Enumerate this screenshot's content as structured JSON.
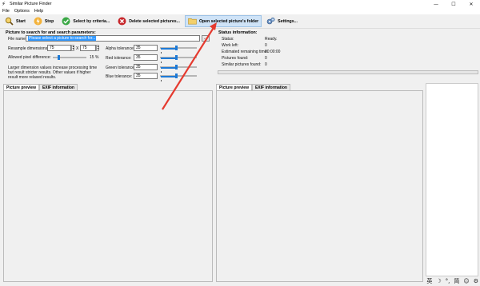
{
  "window": {
    "title": "Similar Picture Finder",
    "controls": {
      "minimize": "—",
      "maximize": "☐",
      "close": "✕"
    }
  },
  "menu": {
    "items": [
      "File",
      "Options",
      "Help"
    ]
  },
  "toolbar": {
    "start": "Start",
    "stop": "Stop",
    "select_by_criteria": "Select by criteria...",
    "delete_selected": "Delete selected pictures...",
    "open_folder": "Open selected picture's folder",
    "settings": "Settings..."
  },
  "search": {
    "group_title": "Picture to search for and search parameters:",
    "file_name_label": "File name:",
    "file_name_value": "Please select a picture to search for...",
    "browse_label": "...",
    "resample_label": "Resample dimensions:",
    "resample_w": "75",
    "resample_x": "X",
    "resample_h": "75",
    "allowed_diff_label": "Allowed pixel difference:",
    "allowed_diff_value": "15 %",
    "allowed_diff_level": 0.15,
    "hint": "Larger dimension values increase processing time but result stricter results. Other values if higher result more relaxed results.",
    "alpha_label": "Alpha tolerance:",
    "alpha_value": "35",
    "red_label": "Red tolerance:",
    "red_value": "35",
    "green_label": "Green tolerance:",
    "green_value": "35",
    "blue_label": "Blue tolerance:",
    "blue_value": "35"
  },
  "left_tabs": {
    "preview": "Picture preview",
    "exif": "EXIF information"
  },
  "status": {
    "group_title": "Status information:",
    "status_label": "Status:",
    "status_value": "Ready.",
    "work_left_label": "Work left:",
    "work_left_value": "0",
    "remaining_label": "Estimated remaining time:",
    "remaining_value": "00:00:00",
    "pictures_found_label": "Pictures found:",
    "pictures_found_value": "0",
    "similar_found_label": "Similar pictures found:",
    "similar_found_value": "0"
  },
  "right_tabs": {
    "preview": "Picture preview",
    "exif": "EXIF information"
  },
  "tray": {
    "ime": "英",
    "moon": "☽",
    "dot": "°,",
    "simplified": "简",
    "smile": "☺",
    "gear": "⚙"
  },
  "colors": {
    "accent": "#1e7ad6",
    "arrow": "#e53a2f",
    "selection": "#3399ff"
  }
}
